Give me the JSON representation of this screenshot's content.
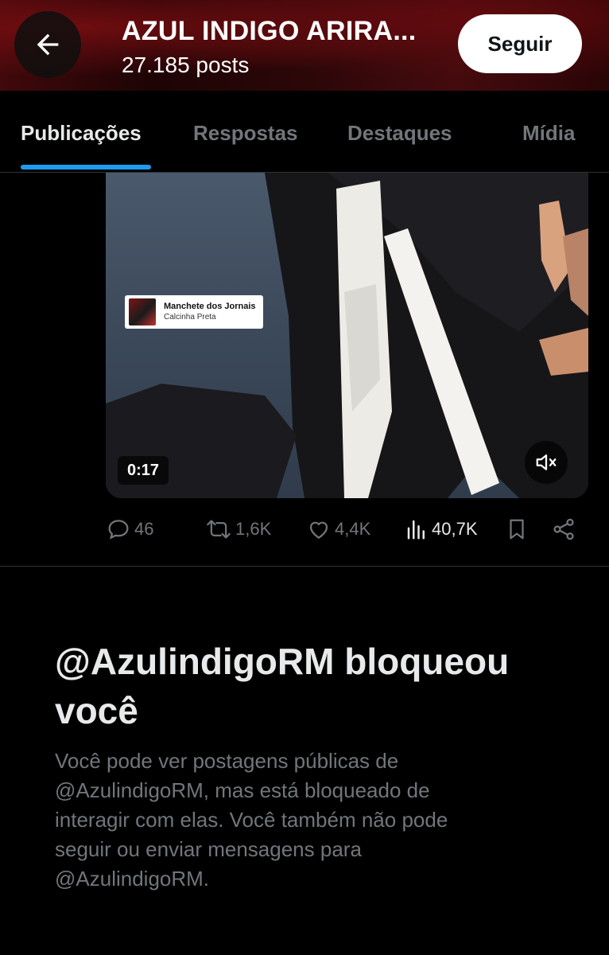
{
  "header": {
    "title": "AZUL INDIGO ARIRA...",
    "posts_count": "27.185 posts",
    "follow_label": "Seguir",
    "back_icon": "arrow-left-icon"
  },
  "tabs": [
    {
      "label": "Publicações",
      "active": true
    },
    {
      "label": "Respostas",
      "active": false
    },
    {
      "label": "Destaques",
      "active": false
    },
    {
      "label": "Mídia",
      "active": false
    }
  ],
  "video": {
    "music": {
      "title": "Manchete dos Jornais",
      "artist": "Calcinha Preta"
    },
    "duration": "0:17",
    "muted": true
  },
  "actions": {
    "replies": "46",
    "reposts": "1,6K",
    "likes": "4,4K",
    "views": "40,7K"
  },
  "blocked": {
    "title": "@AzulindigoRM bloqueou você",
    "body": "Você pode ver postagens públicas de @AzulindigoRM, mas está bloqueado de interagir com elas. Você também não pode seguir ou enviar mensagens para @AzulindigoRM."
  },
  "colors": {
    "accent": "#1d9bf0",
    "background": "#000000",
    "muted_text": "#71767b",
    "primary_text": "#e7e9ea"
  }
}
